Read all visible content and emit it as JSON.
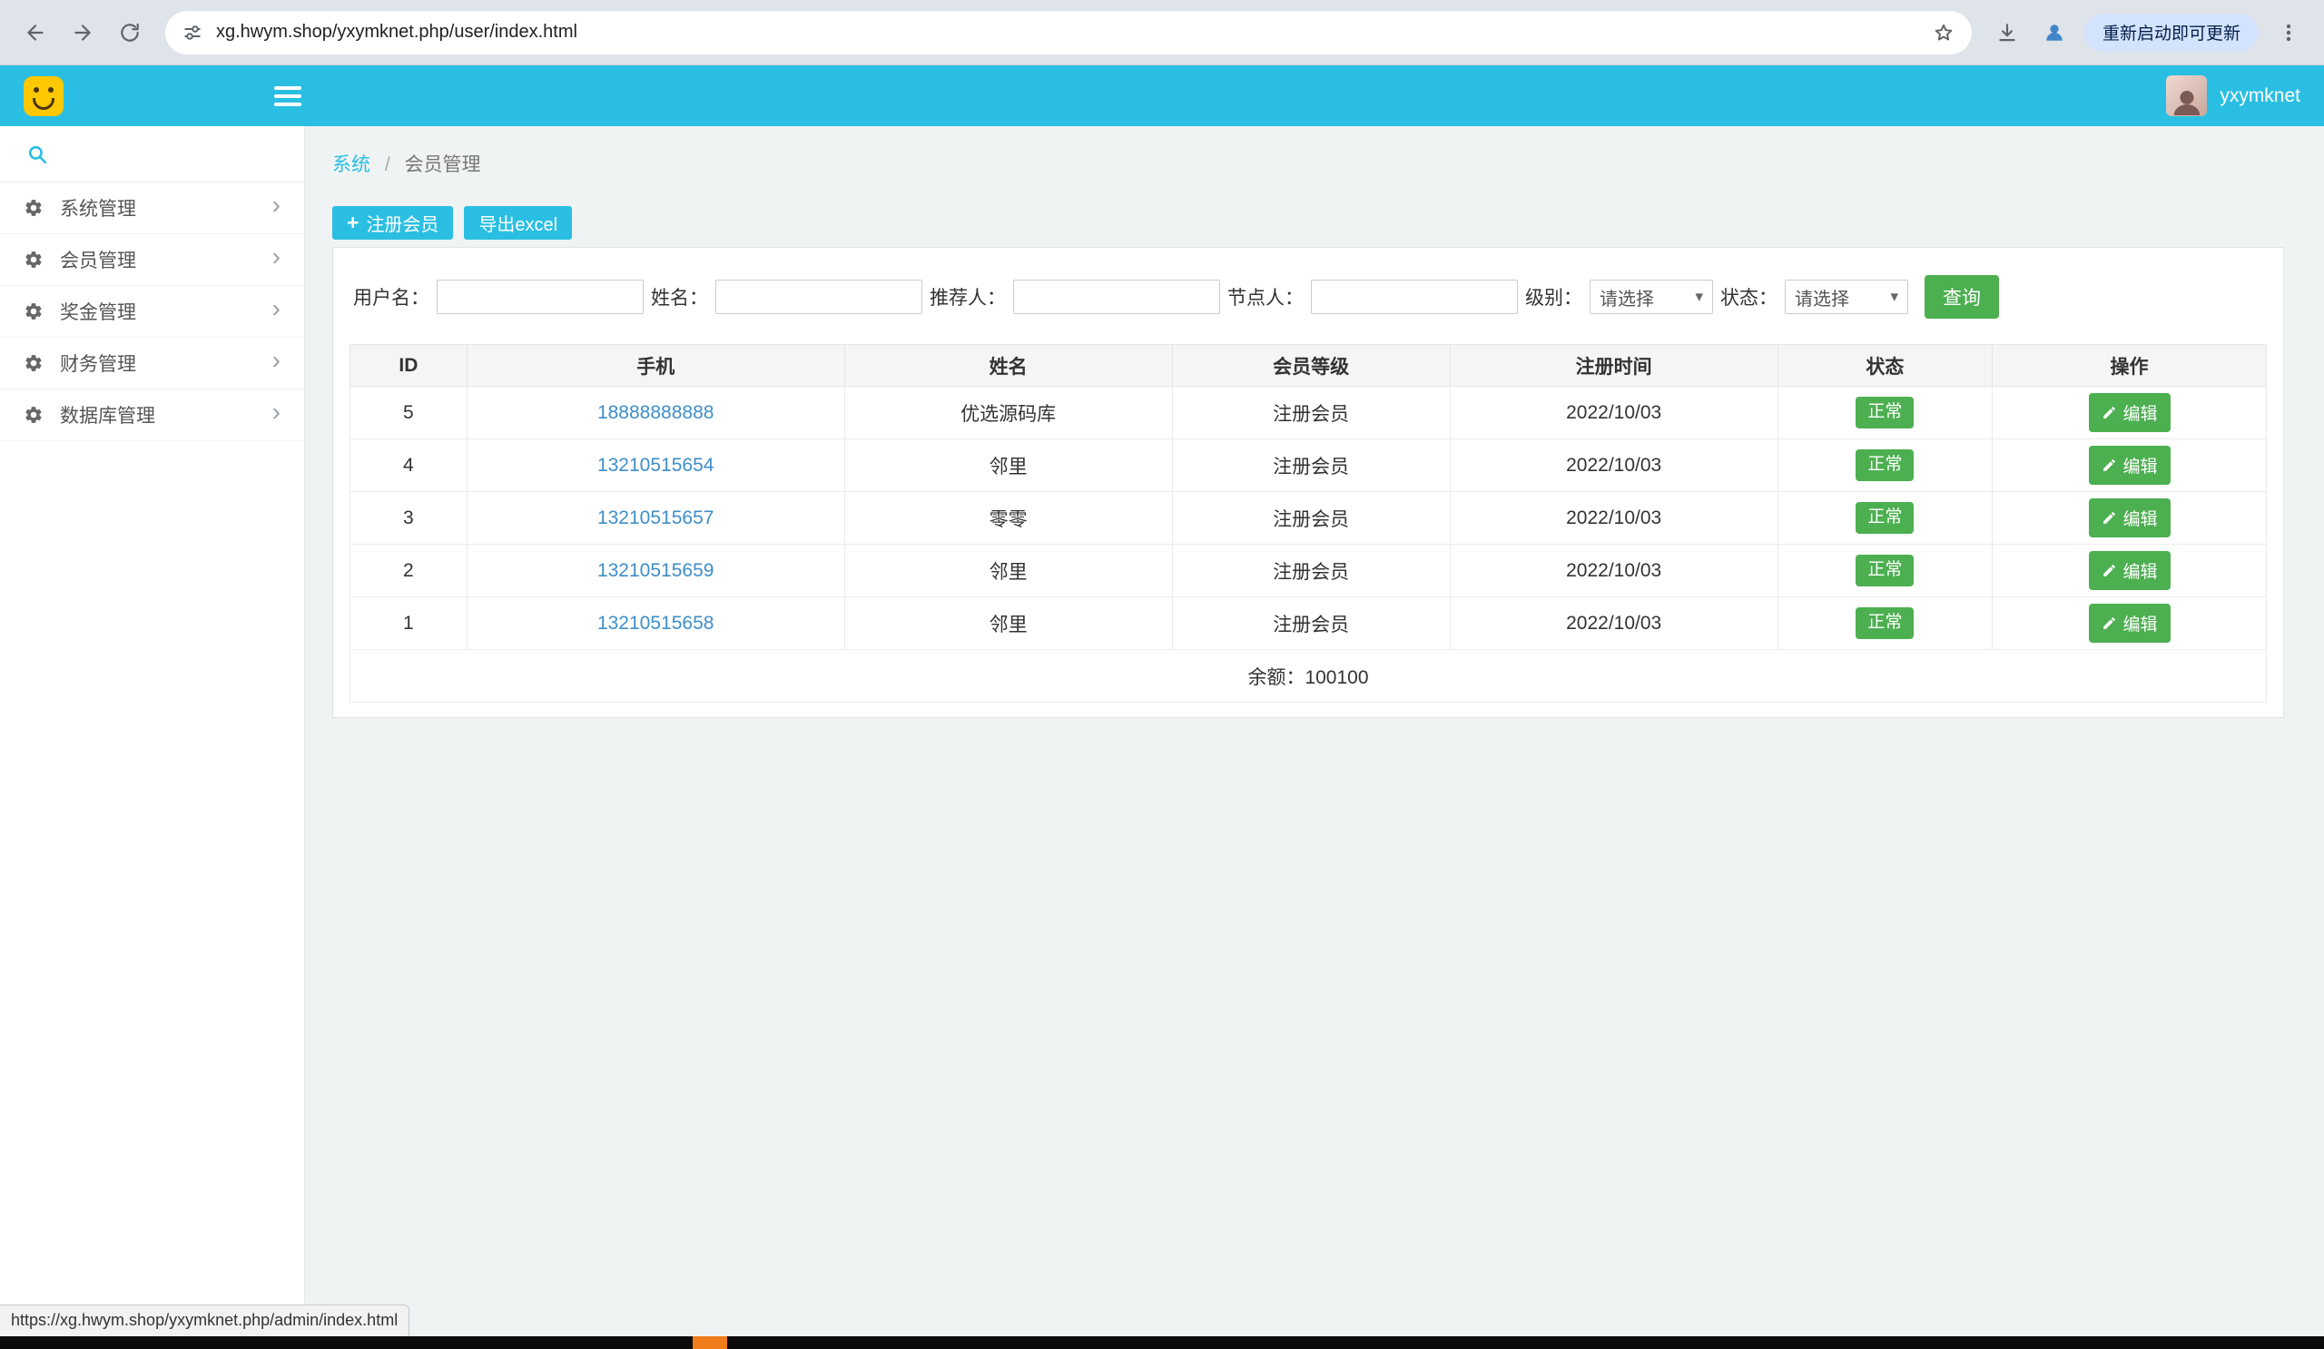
{
  "browser": {
    "url": "xg.hwym.shop/yxymknet.php/user/index.html",
    "update_label": "重新启动即可更新",
    "status_link": "https://xg.hwym.shop/yxymknet.php/admin/index.html"
  },
  "header": {
    "username": "yxymknet"
  },
  "sidebar": {
    "items": [
      {
        "label": "系统管理"
      },
      {
        "label": "会员管理"
      },
      {
        "label": "奖金管理"
      },
      {
        "label": "财务管理"
      },
      {
        "label": "数据库管理"
      }
    ]
  },
  "breadcrumb": {
    "root": "系统",
    "separator": "/",
    "current": "会员管理"
  },
  "toolbar": {
    "register": "注册会员",
    "export": "导出excel"
  },
  "filters": {
    "username": "用户名：",
    "name": "姓名：",
    "referrer": "推荐人：",
    "node": "节点人：",
    "level": "级别：",
    "status": "状态：",
    "select_placeholder": "请选择",
    "search": "查询"
  },
  "table": {
    "headers": [
      "ID",
      "手机",
      "姓名",
      "会员等级",
      "注册时间",
      "状态",
      "操作"
    ],
    "rows": [
      {
        "id": "5",
        "phone": "18888888888",
        "name": "优选源码库",
        "level": "注册会员",
        "reg_time": "2022/10/03",
        "status": "正常",
        "action": "编辑"
      },
      {
        "id": "4",
        "phone": "13210515654",
        "name": "邻里",
        "level": "注册会员",
        "reg_time": "2022/10/03",
        "status": "正常",
        "action": "编辑"
      },
      {
        "id": "3",
        "phone": "13210515657",
        "name": "零零",
        "level": "注册会员",
        "reg_time": "2022/10/03",
        "status": "正常",
        "action": "编辑"
      },
      {
        "id": "2",
        "phone": "13210515659",
        "name": "邻里",
        "level": "注册会员",
        "reg_time": "2022/10/03",
        "status": "正常",
        "action": "编辑"
      },
      {
        "id": "1",
        "phone": "13210515658",
        "name": "邻里",
        "level": "注册会员",
        "reg_time": "2022/10/03",
        "status": "正常",
        "action": "编辑"
      }
    ],
    "footer_balance": "余额：100100"
  },
  "icons": {
    "plus": "+",
    "chevron_right": "›",
    "caret_down": "▾"
  },
  "colors": {
    "accent_cyan": "#2ABFE2",
    "green": "#4CAF50",
    "link_blue": "#3e8ec8",
    "logo_yellow": "#ffc800",
    "update_chip_bg": "#d3e3fd",
    "taskbar_orange": "#ef7d1a"
  }
}
